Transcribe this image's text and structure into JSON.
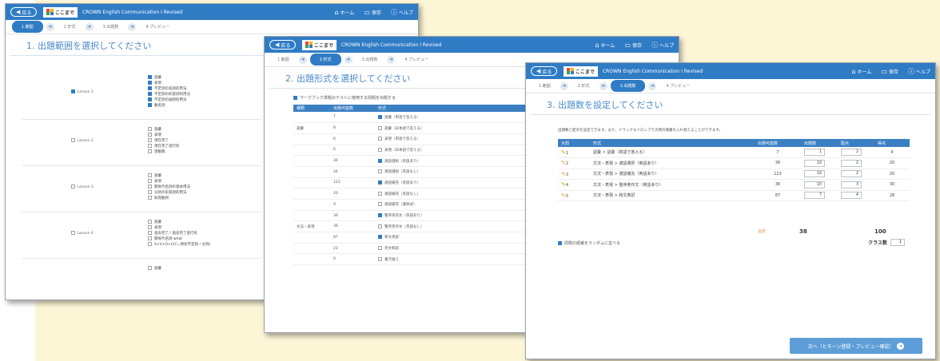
{
  "colors": {
    "accent": "#2f7cc5",
    "header_bg": "#3b7fc3",
    "background": "#fdf6d6",
    "total_orange": "#e07820"
  },
  "header": {
    "back_label": "戻る",
    "logo_text": "ここまで",
    "app_title": "CROWN English Communication I Revised",
    "home_label": "ホーム",
    "save_label": "保存",
    "help_label": "ヘルプ"
  },
  "steps": [
    "1.範囲",
    "2.形式",
    "3.出題数",
    "4.プレビュー"
  ],
  "win1": {
    "heading": "1. 出題範囲を選択してください",
    "lessons": [
      {
        "name": "Lesson 1",
        "checked": true,
        "items": [
          {
            "label": "語彙",
            "checked": true
          },
          {
            "label": "表現",
            "checked": true
          },
          {
            "label": "不定詞の名詞的用法",
            "checked": true
          },
          {
            "label": "不定詞の形容詞的用法",
            "checked": true
          },
          {
            "label": "不定詞の副詞的用法",
            "checked": true
          },
          {
            "label": "動名詞",
            "checked": true
          }
        ]
      },
      {
        "name": "Lesson 2",
        "checked": false,
        "items": [
          {
            "label": "語彙",
            "checked": false
          },
          {
            "label": "表現",
            "checked": false
          },
          {
            "label": "現在完了",
            "checked": false
          },
          {
            "label": "現在完了進行形",
            "checked": false
          },
          {
            "label": "受動態",
            "checked": false
          }
        ]
      },
      {
        "name": "Lesson 3",
        "checked": false,
        "items": [
          {
            "label": "語彙",
            "checked": false
          },
          {
            "label": "表現",
            "checked": false
          },
          {
            "label": "関係代名詞の基本用法",
            "checked": false
          },
          {
            "label": "分詞の形容詞的用法",
            "checked": false
          },
          {
            "label": "知覚動詞",
            "checked": false
          }
        ]
      },
      {
        "name": "Lesson 4",
        "checked": false,
        "items": [
          {
            "label": "語彙",
            "checked": false
          },
          {
            "label": "表現",
            "checked": false
          },
          {
            "label": "過去完了 / 過去完了進行形",
            "checked": false
          },
          {
            "label": "関係代名詞 what",
            "checked": false
          },
          {
            "label": "S+V+O+C(C=原形不定詞 / 分詞)",
            "checked": false
          }
        ]
      },
      {
        "name": "",
        "checked": false,
        "items": [
          {
            "label": "語彙",
            "checked": false
          }
        ]
      }
    ]
  },
  "win2": {
    "heading": "2. 出題形式を選択してください",
    "option_label": "ワークブック準拠のテストに使用する問題を出題する",
    "columns": [
      "種類",
      "出題可能数",
      "形式"
    ],
    "rows": [
      {
        "type": "",
        "count": "7",
        "format": "語彙（単語で答える）",
        "checked": true
      },
      {
        "type": "語彙",
        "count": "8",
        "format": "語彙（日本語で答える）",
        "checked": false
      },
      {
        "type": "",
        "count": "6",
        "format": "表現（単語で答える）",
        "checked": false
      },
      {
        "type": "",
        "count": "6",
        "format": "表現（日本語で答える）",
        "checked": false
      },
      {
        "type": "",
        "count": "36",
        "format": "適語選択（英語あり）",
        "checked": true
      },
      {
        "type": "",
        "count": "34",
        "format": "適語選択（英語なし）",
        "checked": false
      },
      {
        "type": "",
        "count": "123",
        "format": "適語補充（英語あり）",
        "checked": true
      },
      {
        "type": "",
        "count": "20",
        "format": "適語補充（英語なし）",
        "checked": false
      },
      {
        "type": "",
        "count": "9",
        "format": "適語補充（選択式）",
        "checked": false
      },
      {
        "type": "",
        "count": "36",
        "format": "整序英作文（英語あり）",
        "checked": true
      },
      {
        "type": "文法・表現",
        "count": "36",
        "format": "整序英作文（英語なし）",
        "checked": false
      },
      {
        "type": "",
        "count": "87",
        "format": "和文英訳",
        "checked": true
      },
      {
        "type": "",
        "count": "23",
        "format": "英文和訳",
        "checked": false
      },
      {
        "type": "",
        "count": "0",
        "format": "書き換え",
        "checked": false
      }
    ]
  },
  "win3": {
    "heading": "3. 出題数を設定してください",
    "instruction": "出題数と配点を設定できます。また、ドラッグ＆ドロップで大問の順番を入れ替えることができます。",
    "columns": [
      "大問",
      "形式",
      "出題可能数",
      "出題数",
      "配点",
      "得点"
    ],
    "rows": [
      {
        "num": "1",
        "format": "語彙 > 語彙（単語で答える）",
        "available": "7",
        "count": "1",
        "points": "2",
        "score": "4"
      },
      {
        "num": "2",
        "format": "文法・表現 > 適語選択（英語あり）",
        "available": "36",
        "count": "10",
        "points": "2",
        "score": "20"
      },
      {
        "num": "3",
        "format": "文法・表現 > 適語補充（英語あり）",
        "available": "123",
        "count": "10",
        "points": "2",
        "score": "20"
      },
      {
        "num": "4",
        "format": "文法・表現 > 整序英作文（英語あり）",
        "available": "36",
        "count": "10",
        "points": "3",
        "score": "30"
      },
      {
        "num": "5",
        "format": "文法・表現 > 和文英訳",
        "available": "87",
        "count": "7",
        "points": "4",
        "score": "28"
      }
    ],
    "total_label": "合計",
    "total_count": "38",
    "total_score": "100",
    "shuffle_label": "問題の順番をランダムに並べる",
    "class_label": "クラス数",
    "class_value": "1",
    "next_button": "次へ（ヒモーン登録・プレビュー確認）"
  }
}
